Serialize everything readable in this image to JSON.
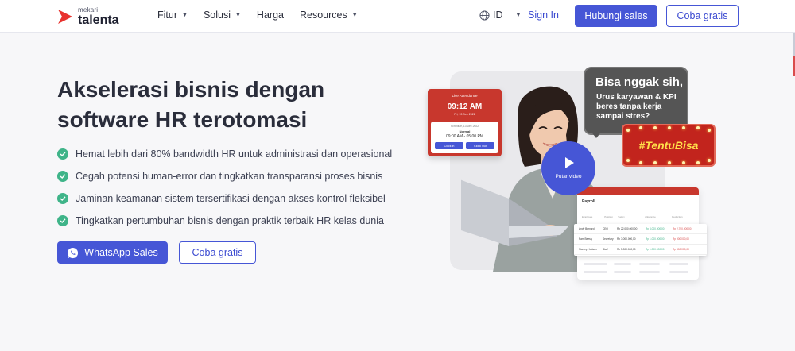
{
  "header": {
    "logo_small": "mekari",
    "logo_big": "talenta",
    "nav": [
      {
        "label": "Fitur",
        "has_dropdown": true
      },
      {
        "label": "Solusi",
        "has_dropdown": true
      },
      {
        "label": "Harga",
        "has_dropdown": false
      },
      {
        "label": "Resources",
        "has_dropdown": true
      }
    ],
    "language": "ID",
    "sign_in": "Sign In",
    "contact_sales": "Hubungi sales",
    "try_free": "Coba gratis"
  },
  "hero": {
    "title": "Akselerasi bisnis dengan software HR terotomasi",
    "features": [
      "Hemat lebih dari 80% bandwidth HR untuk administrasi dan operasional",
      "Cegah potensi human-error dan tingkatkan transparansi proses bisnis",
      "Jaminan keamanan sistem tersertifikasi dengan akses kontrol fleksibel",
      "Tingkatkan pertumbuhan bisnis dengan praktik terbaik HR kelas dunia"
    ],
    "whatsapp_button": "WhatsApp Sales",
    "try_button": "Coba gratis"
  },
  "illustration": {
    "attendance": {
      "heading": "Live Attendance",
      "time": "09:12 AM",
      "date": "Fri, 13 Dec 2022",
      "schedule": "Schedule, 13 Dec 2022",
      "shift": "Normal",
      "range": "09:00 AM - 05:00 PM",
      "clock_in": "Clock in",
      "clock_out": "Clock Out"
    },
    "bubble_big": "Bisa nggak sih,",
    "bubble_small": "Urus karyawan & KPI beres tanpa kerja sampai stres?",
    "banner": "#TentuBisa",
    "play_label": "Putar video",
    "payroll": {
      "title": "Payroll",
      "columns": [
        "Employee",
        "Position",
        "Salary",
        "Allowance",
        "Deduction"
      ],
      "rows": [
        [
          "Andy Bernard",
          "CEO",
          "Rp 22.000.000,00",
          "Rp 4.000.000,00",
          "Rp 2.700.000,00"
        ],
        [
          "Pam Beesly",
          "Secretary",
          "Rp 7.000.000,00",
          "Rp 1.000.000,00",
          "Rp 900.000,00"
        ],
        [
          "Stanley Hudson",
          "Staff",
          "Rp 5.000.000,00",
          "Rp 1.000.000,00",
          "Rp 300.000,00"
        ]
      ]
    }
  },
  "colors": {
    "primary": "#4656d6",
    "check_green": "#3fb489",
    "brand_red": "#c8372d"
  }
}
